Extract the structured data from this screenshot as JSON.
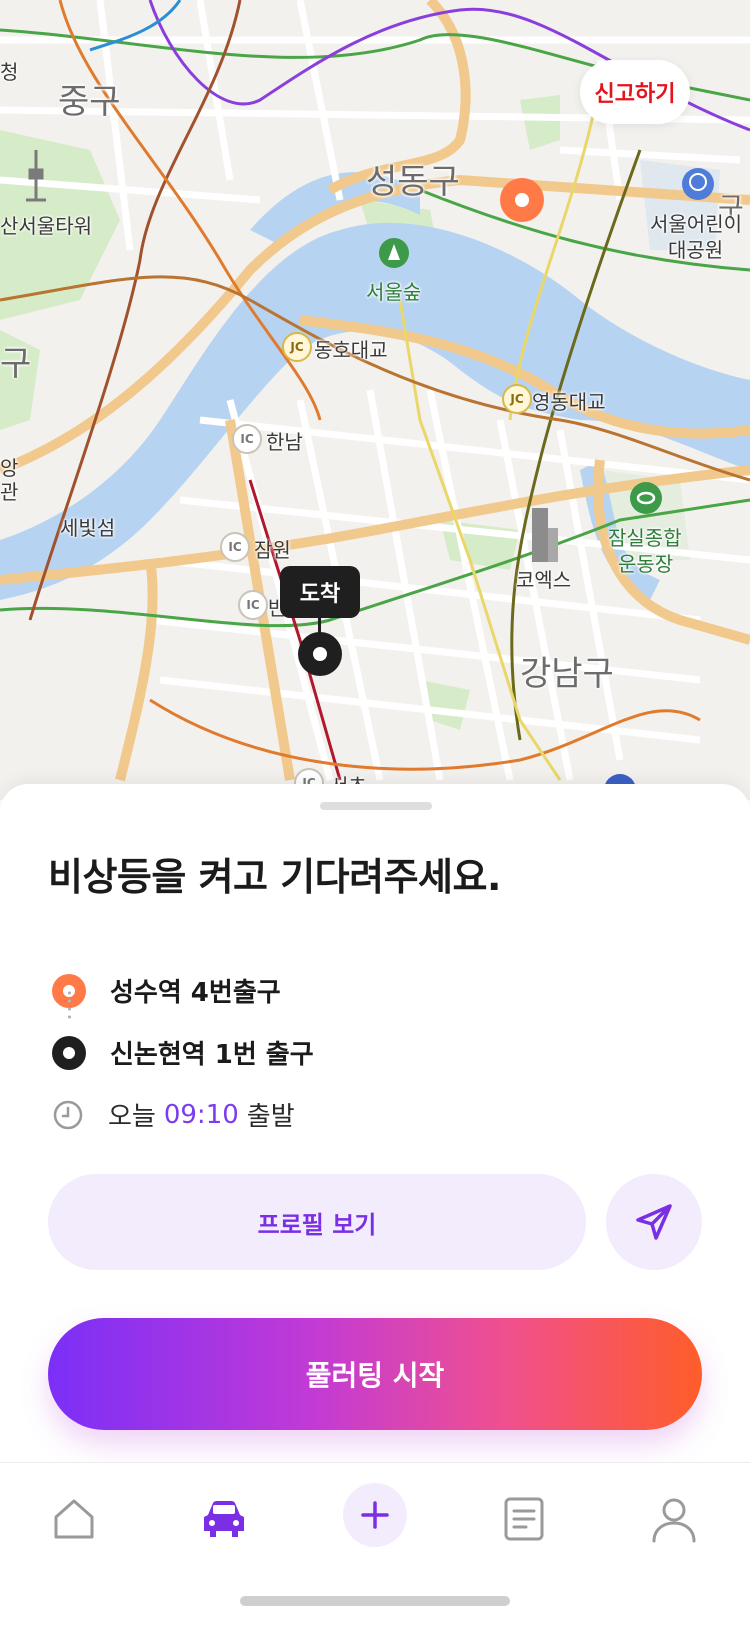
{
  "map": {
    "labels": {
      "junggu": "중구",
      "seongdonggu": "성동구",
      "gangnamgu": "강남구",
      "yongsan_partial": "구",
      "namsan_tower": "산서울타워",
      "seoul_forest": "서울숲",
      "childrens_park_line1": "서울어린이",
      "childrens_park_line2": "대공원",
      "dongho_bridge": "동호대교",
      "yeongdong_bridge": "영동대교",
      "hannam": "한남",
      "jamwon": "잠원",
      "ban_partial": "반",
      "seocho_partial": "서초",
      "sebit_island": "세빛섬",
      "coex": "코엑스",
      "jamsil_line1": "잠실종합",
      "jamsil_line2": "운동장",
      "top_left_partial": "청",
      "left_partial_1": "앙",
      "left_partial_2": "관",
      "right_top_partial": "구",
      "ic": "IC",
      "jc": "JC"
    },
    "report_button": "신고하기",
    "destination_tooltip": "도착",
    "colors": {
      "origin": "#ff7a46",
      "destination": "#1f1f1f",
      "river": "#b7d3f2",
      "park": "#d6ebc7"
    }
  },
  "sheet": {
    "title": "비상등을 켜고 기다려주세요.",
    "origin": "성수역 4번출구",
    "destination": "신논현역 1번 출구",
    "time_prefix": "오늘",
    "time_value": "09:10",
    "time_suffix": "출발",
    "profile_button": "프로필 보기",
    "share_icon": "send-icon",
    "start_button": "풀러팅 시작",
    "accent": "#7a2fe5"
  },
  "tabbar": {
    "items": [
      "home-icon",
      "car-icon",
      "plus-icon",
      "document-icon",
      "profile-icon"
    ],
    "active": "car-icon"
  }
}
